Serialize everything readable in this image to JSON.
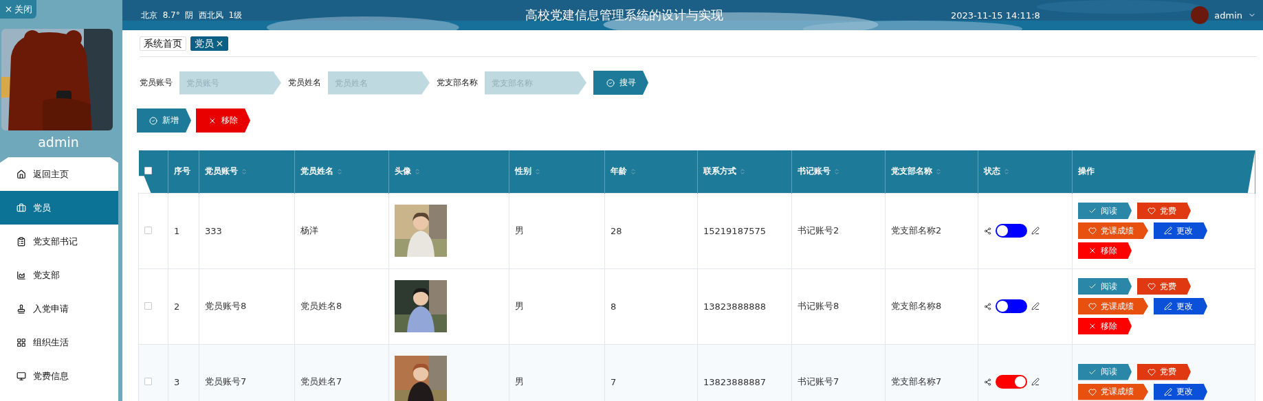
{
  "close_button": {
    "label": "关闭"
  },
  "profile": {
    "avatar": {
      "kind": "picture"
    },
    "name": "admin"
  },
  "sidebar": {
    "items": [
      {
        "label": "返回主页",
        "selected": false
      },
      {
        "label": "党员",
        "selected": true
      },
      {
        "label": "党支部书记",
        "selected": false
      },
      {
        "label": "党支部",
        "selected": false
      },
      {
        "label": "入党申请",
        "selected": false
      },
      {
        "label": "组织生活",
        "selected": false
      },
      {
        "label": "党费信息",
        "selected": false
      }
    ]
  },
  "header": {
    "weather": "北京  8.7°  阴  西北风  1级",
    "title": "高校党建信息管理系统的设计与实现",
    "datetime": "2023-11-15 14:11:8",
    "user": "admin"
  },
  "tabs": [
    {
      "label": "系统首页",
      "selected": false,
      "closable": false
    },
    {
      "label": "党员",
      "selected": true,
      "closable": true
    }
  ],
  "filters": [
    {
      "label": "党员账号",
      "placeholder": "党员账号"
    },
    {
      "label": "党员姓名",
      "placeholder": "党员姓名"
    },
    {
      "label": "党支部名称",
      "placeholder": "党支部名称"
    }
  ],
  "search_button": {
    "label": "搜寻"
  },
  "toolbar": [
    {
      "label": "新增",
      "kind": "add"
    },
    {
      "label": "移除",
      "kind": "remove"
    }
  ],
  "table": {
    "all_checked": false,
    "columns": [
      {
        "label": "序号",
        "sortable": false
      },
      {
        "label": "党员账号",
        "sortable": true
      },
      {
        "label": "党员姓名",
        "sortable": true
      },
      {
        "label": "头像",
        "sortable": true
      },
      {
        "label": "性别",
        "sortable": true
      },
      {
        "label": "年龄",
        "sortable": true
      },
      {
        "label": "联系方式",
        "sortable": true
      },
      {
        "label": "书记账号",
        "sortable": true
      },
      {
        "label": "党支部名称",
        "sortable": true
      },
      {
        "label": "状态",
        "sortable": true
      },
      {
        "label": "操作",
        "sortable": false
      }
    ],
    "rows": [
      {
        "checked": false,
        "cells": [
          "1",
          "333",
          "杨洋"
        ],
        "avatar": {
          "kind": "picture"
        },
        "rest": [
          "男",
          "28",
          "15219187575",
          "书记账号2",
          "党支部名称2"
        ],
        "status_on": false,
        "actions": [
          {
            "label": "阅读",
            "kind": "view"
          },
          {
            "label": "党费",
            "kind": "fee"
          },
          {
            "label": "党课成绩",
            "kind": "grades"
          },
          {
            "label": "更改",
            "kind": "edit"
          },
          {
            "label": "移除",
            "kind": "remove"
          }
        ]
      },
      {
        "checked": false,
        "cells": [
          "2",
          "党员账号8",
          "党员姓名8"
        ],
        "avatar": {
          "kind": "picture"
        },
        "rest": [
          "男",
          "8",
          "13823888888",
          "书记账号8",
          "党支部名称8"
        ],
        "status_on": false,
        "actions": [
          {
            "label": "阅读",
            "kind": "view"
          },
          {
            "label": "党费",
            "kind": "fee"
          },
          {
            "label": "党课成绩",
            "kind": "grades"
          },
          {
            "label": "更改",
            "kind": "edit"
          },
          {
            "label": "移除",
            "kind": "remove"
          }
        ]
      },
      {
        "checked": false,
        "cells": [
          "3",
          "党员账号7",
          "党员姓名7"
        ],
        "avatar": {
          "kind": "picture"
        },
        "rest": [
          "男",
          "7",
          "13823888887",
          "书记账号7",
          "党支部名称7"
        ],
        "status_on": true,
        "actions": [
          {
            "label": "阅读",
            "kind": "view"
          },
          {
            "label": "党费",
            "kind": "fee"
          },
          {
            "label": "党课成绩",
            "kind": "grades"
          },
          {
            "label": "更改",
            "kind": "edit"
          }
        ]
      }
    ]
  }
}
